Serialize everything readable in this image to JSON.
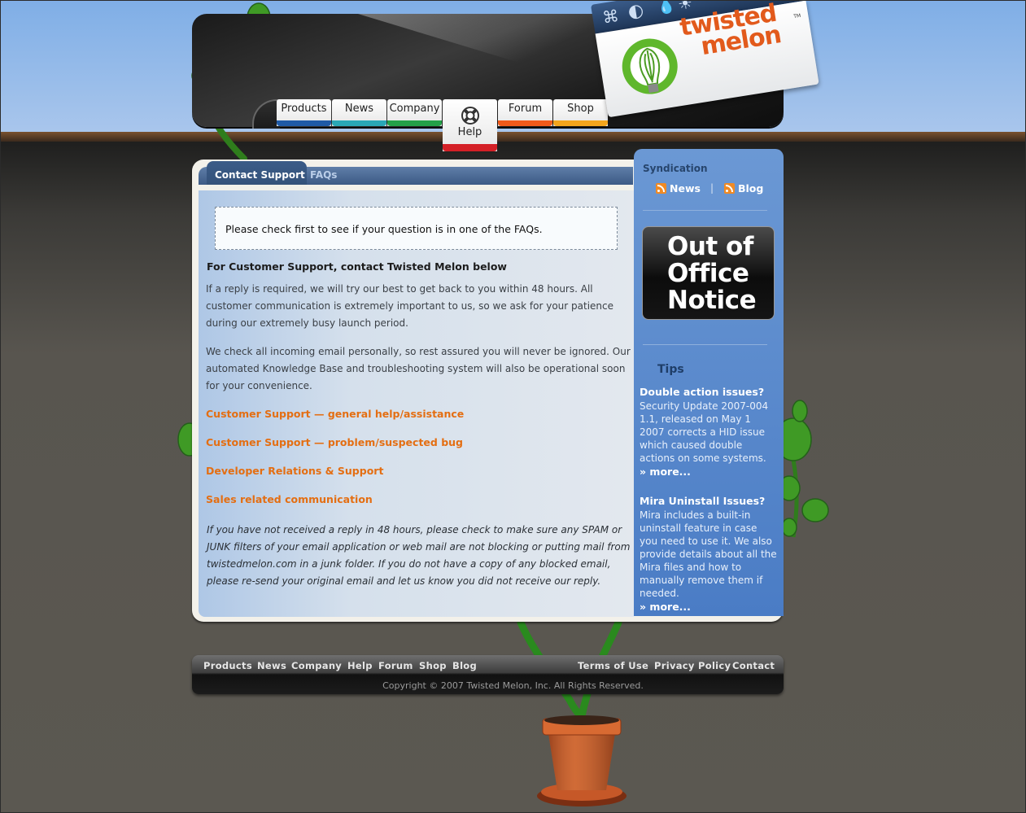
{
  "brand": {
    "logo_text_line1": "twisted",
    "logo_text_line2": "melon",
    "trademark": "TM",
    "card_icons": [
      "command-key-icon",
      "yin-yang-icon",
      "droplet-icon",
      "sun-icon"
    ]
  },
  "nav": {
    "items": [
      {
        "label": "Products",
        "color": "#1f5aa6"
      },
      {
        "label": "News",
        "color": "#2aa7b6"
      },
      {
        "label": "Company",
        "color": "#24a048"
      },
      {
        "label": "Help",
        "color": "#d41f26"
      },
      {
        "label": "Forum",
        "color": "#f05a1a"
      },
      {
        "label": "Shop",
        "color": "#f3a51d"
      }
    ]
  },
  "tabs": {
    "active": "Contact Support",
    "other": "FAQs"
  },
  "main": {
    "notice": "Please check first to see if your question is in one of the FAQs.",
    "heading": "For Customer Support, contact Twisted Melon below",
    "paragraph1": "If a reply is required, we will try our best to get back to you within 48 hours. All customer communication is extremely important to us, so we ask for your patience during our extremely busy launch period.",
    "paragraph2": "We check all incoming email personally, so rest assured you will never be ignored. Our automated Knowledge Base and troubleshooting system will also be operational soon for your convenience.",
    "links": [
      "Customer Support — general help/assistance",
      "Customer Support — problem/suspected bug",
      "Developer Relations & Support",
      "Sales related communication"
    ],
    "note": "If you have not received a reply in 48 hours, please check to make sure any SPAM or JUNK filters of your email application or web mail are not blocking or putting mail from twistedmelon.com in a junk folder. If you do not have a copy of any blocked email, please re-send your original email and let us know you did not receive our reply."
  },
  "sidebar": {
    "syndication_heading": "Syndication",
    "feeds": [
      "News",
      "Blog"
    ],
    "separator": "|",
    "out_of_office": [
      "Out of",
      "Office",
      "Notice"
    ],
    "tips_heading": "Tips",
    "tips": [
      {
        "title": "Double action issues?",
        "body": "Security Update 2007-004 1.1, released on May 1 2007 corrects a HID issue which caused double actions on some systems.",
        "more": "» more..."
      },
      {
        "title": "Mira Uninstall Issues?",
        "body": "Mira includes a built-in uninstall feature in case you need to use it. We also provide details about all the Mira files and how to manually remove them if needed.",
        "more": "» more..."
      }
    ]
  },
  "footer": {
    "left_links": [
      "Products",
      "News",
      "Company",
      "Help",
      "Forum",
      "Shop",
      "Blog"
    ],
    "right_links": [
      "Terms of Use",
      "Privacy Policy",
      "Contact"
    ],
    "copyright": "Copyright © 2007 Twisted Melon, Inc. All Rights Reserved."
  },
  "colors": {
    "link_orange": "#e46e12",
    "sidebar_blue": "#5b8bcd",
    "brand_green": "#62b52e",
    "brand_orange": "#e25a1c"
  }
}
